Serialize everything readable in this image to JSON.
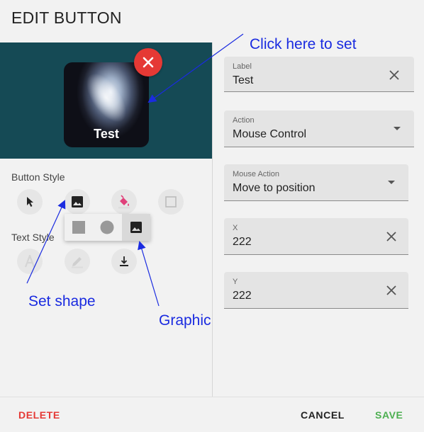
{
  "dialog": {
    "title": "EDIT BUTTON"
  },
  "preview": {
    "button_label": "Test"
  },
  "styles": {
    "button_style_label": "Button Style",
    "text_style_label": "Text Style"
  },
  "fields": {
    "label": {
      "label": "Label",
      "value": "Test"
    },
    "action": {
      "label": "Action",
      "value": "Mouse Control"
    },
    "mouse_action": {
      "label": "Mouse Action",
      "value": "Move to position"
    },
    "x": {
      "label": "X",
      "value": "222"
    },
    "y": {
      "label": "Y",
      "value": "222"
    }
  },
  "annotations": {
    "click_here": "Click here to set",
    "set_shape": "Set shape",
    "graphic": "Graphic"
  },
  "footer": {
    "delete": "DELETE",
    "cancel": "CANCEL",
    "save": "SAVE"
  },
  "colors": {
    "preview_bg": "#154a55",
    "delete": "#e53935",
    "save": "#4caf50",
    "annotation": "#1a2be0"
  },
  "icons": [
    "close-icon",
    "cursor-icon",
    "image-icon",
    "fill-bucket-icon",
    "square-outline-icon",
    "text-a-icon",
    "pen-icon",
    "align-bottom-icon",
    "square-shape-icon",
    "circle-shape-icon",
    "clear-icon",
    "dropdown-arrow-icon"
  ]
}
